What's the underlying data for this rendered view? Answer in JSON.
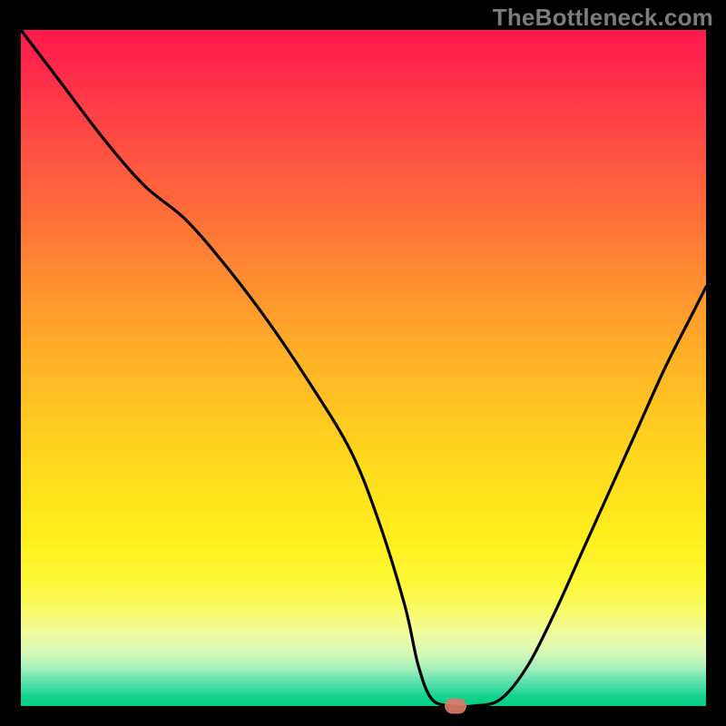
{
  "watermark": "TheBottleneck.com",
  "chart_data": {
    "type": "line",
    "title": "",
    "xlabel": "",
    "ylabel": "",
    "xlim": [
      0,
      100
    ],
    "ylim": [
      0,
      100
    ],
    "x": [
      0,
      6,
      12,
      18,
      24,
      30,
      36,
      42,
      48,
      52,
      56,
      58,
      60,
      63,
      66,
      70,
      74,
      78,
      82,
      86,
      90,
      94,
      98,
      100
    ],
    "values": [
      100,
      92,
      84,
      77,
      72,
      65,
      57,
      48,
      38,
      28,
      15,
      6,
      1,
      0,
      0,
      1,
      6,
      14,
      23,
      32,
      41,
      50,
      58,
      62
    ],
    "marker": {
      "x": 63.5,
      "y": 0
    },
    "gradient_colors": {
      "top": "#ff1a4d",
      "mid": "#ffd41e",
      "bottom": "#00cf82"
    }
  }
}
